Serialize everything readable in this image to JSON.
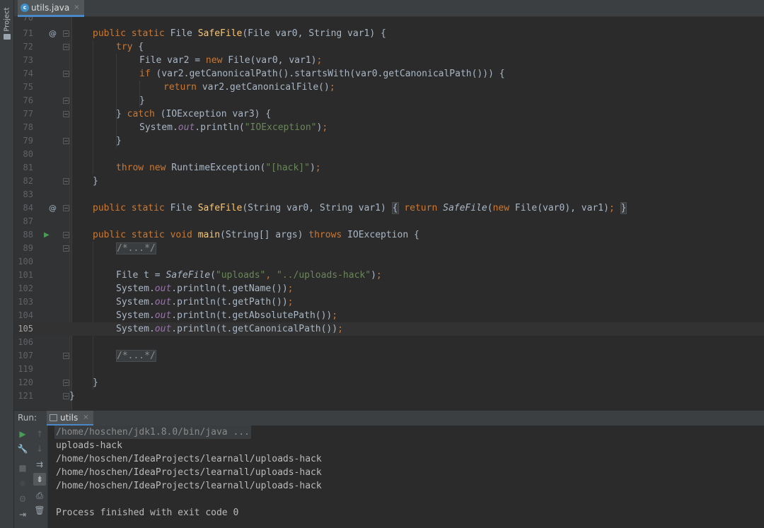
{
  "side_panel": {
    "project_label": "Project"
  },
  "editor": {
    "tab_label": "utils.java",
    "tab_icon": "java-class-icon",
    "close_symbol": "×",
    "current_line": "105"
  },
  "code": {
    "l71": {
      "ln": "71",
      "mods": "public static ",
      "type": "File ",
      "name": "SafeFile",
      "params": "(File var0, String var1) {"
    },
    "l72": {
      "ln": "72",
      "kw": "try",
      "rest": " {"
    },
    "l73": {
      "ln": "73",
      "pre": "File var2 = ",
      "kw": "new",
      "rest": " File(var0, var1)",
      "semi": ";"
    },
    "l74": {
      "ln": "74",
      "kw": "if",
      "rest": " (var2.getCanonicalPath().startsWith(var0.getCanonicalPath())) {"
    },
    "l75": {
      "ln": "75",
      "kw": "return",
      "rest": " var2.getCanonicalFile()",
      "semi": ";"
    },
    "l76": {
      "ln": "76",
      "text": "}"
    },
    "l77": {
      "ln": "77",
      "pre": "} ",
      "kw": "catch",
      "rest": " (IOException var3) {"
    },
    "l78": {
      "ln": "78",
      "pre": "System.",
      "field": "out",
      "mid": ".println(",
      "str": "\"IOException\"",
      "end": ")",
      "semi": ";"
    },
    "l79": {
      "ln": "79",
      "text": "}"
    },
    "l80": {
      "ln": "80"
    },
    "l81": {
      "ln": "81",
      "kw1": "throw",
      "sp": " ",
      "kw2": "new",
      "mid": " RuntimeException(",
      "str": "\"[hack]\"",
      "end": ")",
      "semi": ";"
    },
    "l82": {
      "ln": "82",
      "text": "}"
    },
    "l83": {
      "ln": "83"
    },
    "l84": {
      "ln": "84",
      "mods": "public static ",
      "type": "File ",
      "name": "SafeFile",
      "params": "(String var0, String var1) ",
      "ob": "{",
      "kw_return": " return ",
      "call": "SafeFile",
      "args1": "(",
      "kw_new": "new",
      "args2": " File(var0), var1)",
      "semi": "; ",
      "cb": "}"
    },
    "l87": {
      "ln": "87"
    },
    "l88": {
      "ln": "88",
      "mods": "public static void ",
      "name": "main",
      "params": "(String[] args) ",
      "kw_throws": "throws",
      "rest": " IOException {"
    },
    "l89": {
      "ln": "89",
      "folded": "/*...*/"
    },
    "l100": {
      "ln": "100"
    },
    "l101": {
      "ln": "101",
      "pre": "File t = ",
      "call": "SafeFile",
      "mid": "(",
      "str1": "\"uploads\"",
      "comma": ", ",
      "str2": "\"../uploads-hack\"",
      "end": ")",
      "semi": ";"
    },
    "l102": {
      "ln": "102",
      "pre": "System.",
      "field": "out",
      "rest": ".println(t.getName())",
      "semi": ";"
    },
    "l103": {
      "ln": "103",
      "pre": "System.",
      "field": "out",
      "rest": ".println(t.getPath())",
      "semi": ";"
    },
    "l104": {
      "ln": "104",
      "pre": "System.",
      "field": "out",
      "rest": ".println(t.getAbsolutePath())",
      "semi": ";"
    },
    "l105": {
      "ln": "105",
      "pre": "System.",
      "field": "out",
      "rest": ".println(t.getCanonicalPath())",
      "semi": ";"
    },
    "l106": {
      "ln": "106"
    },
    "l107": {
      "ln": "107",
      "folded": "/*...*/"
    },
    "l119": {
      "ln": "119"
    },
    "l120": {
      "ln": "120",
      "text": "}"
    },
    "l121": {
      "ln": "121",
      "text": "}"
    }
  },
  "gutter_marks": {
    "override": "@",
    "run": "▶"
  },
  "run_panel": {
    "label": "Run:",
    "tab_label": "utils",
    "close_symbol": "×",
    "toolbar_icons": [
      "run-icon",
      "wrench-icon",
      "stop-icon",
      "camera-icon",
      "settings-icon",
      "exit-icon",
      "up-arrow-icon",
      "down-arrow-icon",
      "soft-wrap-icon",
      "scroll-to-end-icon",
      "print-icon",
      "trash-icon"
    ],
    "toolbar_glyphs": {
      "run": "▶",
      "wrench": "🔧",
      "stop": "■",
      "camera": "⌾",
      "settings": "⚙",
      "exit": "⇥",
      "up": "↑",
      "down": "↓",
      "wrap": "⇉",
      "scroll_end": "⇟",
      "print": "⎙",
      "trash": "🗑"
    },
    "console_lines": [
      "/home/hoschen/jdk1.8.0/bin/java ...",
      "uploads-hack",
      "/home/hoschen/IdeaProjects/learnall/uploads-hack",
      "/home/hoschen/IdeaProjects/learnall/uploads-hack",
      "/home/hoschen/IdeaProjects/learnall/uploads-hack",
      "",
      "Process finished with exit code 0"
    ]
  },
  "colors": {
    "background": "#2b2b2b",
    "gutter": "#313335",
    "keyword": "#cc7832",
    "function": "#ffc66d",
    "string": "#6a8759",
    "static_field": "#9876aa",
    "accent": "#4a88c7",
    "run_green": "#499c54"
  }
}
